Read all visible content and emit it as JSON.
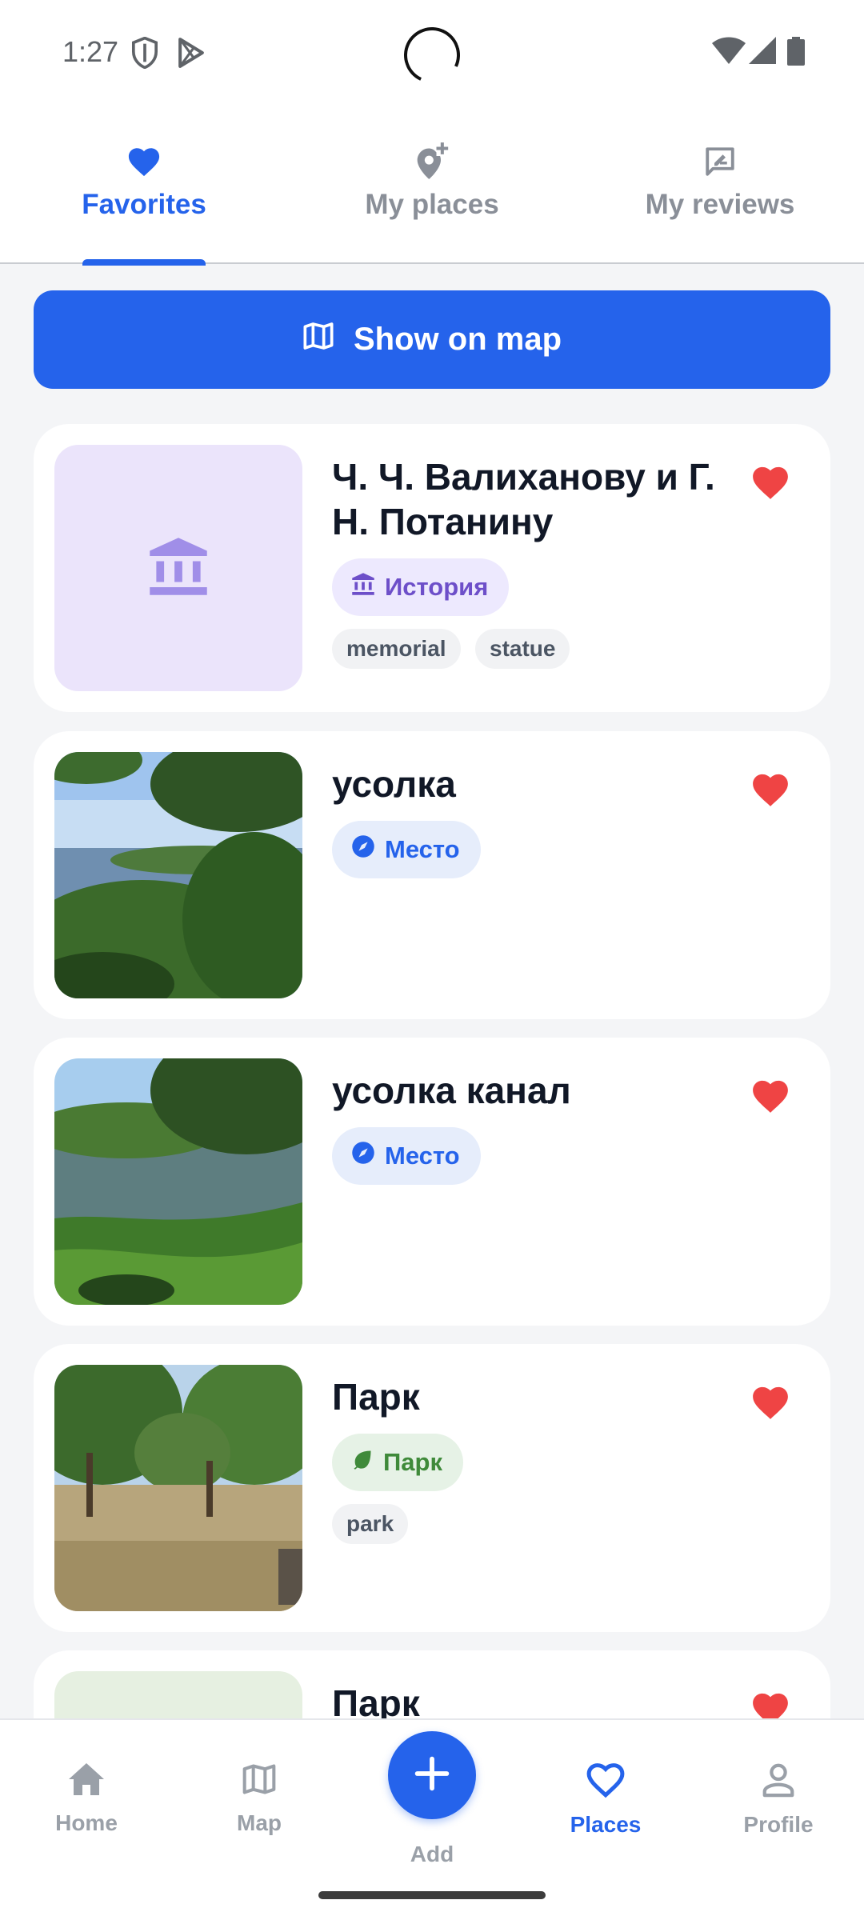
{
  "status_bar": {
    "time": "1:27"
  },
  "tabs": [
    {
      "label": "Favorites",
      "icon": "heart-icon",
      "active": true
    },
    {
      "label": "My places",
      "icon": "add-location-icon",
      "active": false
    },
    {
      "label": "My reviews",
      "icon": "rate-review-icon",
      "active": false
    }
  ],
  "map_button": {
    "label": "Show on map",
    "icon": "map-icon"
  },
  "places": [
    {
      "title": "Ч. Ч. Валиханову и Г. Н. Потанину",
      "category": "История",
      "category_icon": "museum-icon",
      "tags": [
        "memorial",
        "statue"
      ],
      "favorite": true
    },
    {
      "title": "усолка",
      "category": "Место",
      "category_icon": "compass-icon",
      "tags": [],
      "favorite": true
    },
    {
      "title": "усолка канал",
      "category": "Место",
      "category_icon": "compass-icon",
      "tags": [],
      "favorite": true
    },
    {
      "title": "Парк",
      "category": "Парк",
      "category_icon": "leaf-icon",
      "tags": [
        "park"
      ],
      "favorite": true
    },
    {
      "title": "Парк",
      "favorite": true
    }
  ],
  "bottom_nav": {
    "items": [
      {
        "label": "Home",
        "icon": "home-icon",
        "active": false
      },
      {
        "label": "Map",
        "icon": "map-icon",
        "active": false
      },
      {
        "label": "Add",
        "icon": "plus-icon",
        "active": false
      },
      {
        "label": "Places",
        "icon": "heart-outline-icon",
        "active": true
      },
      {
        "label": "Profile",
        "icon": "person-icon",
        "active": false
      }
    ]
  },
  "colors": {
    "accent": "#2563eb",
    "heart": "#ef4444",
    "history_chip_bg": "#ede9fe",
    "history_chip_text": "#6d4fc9",
    "place_chip_bg": "#e6edfb",
    "place_chip_text": "#2563eb",
    "park_chip_bg": "#e6f2e6",
    "park_chip_text": "#3f8a3a"
  }
}
